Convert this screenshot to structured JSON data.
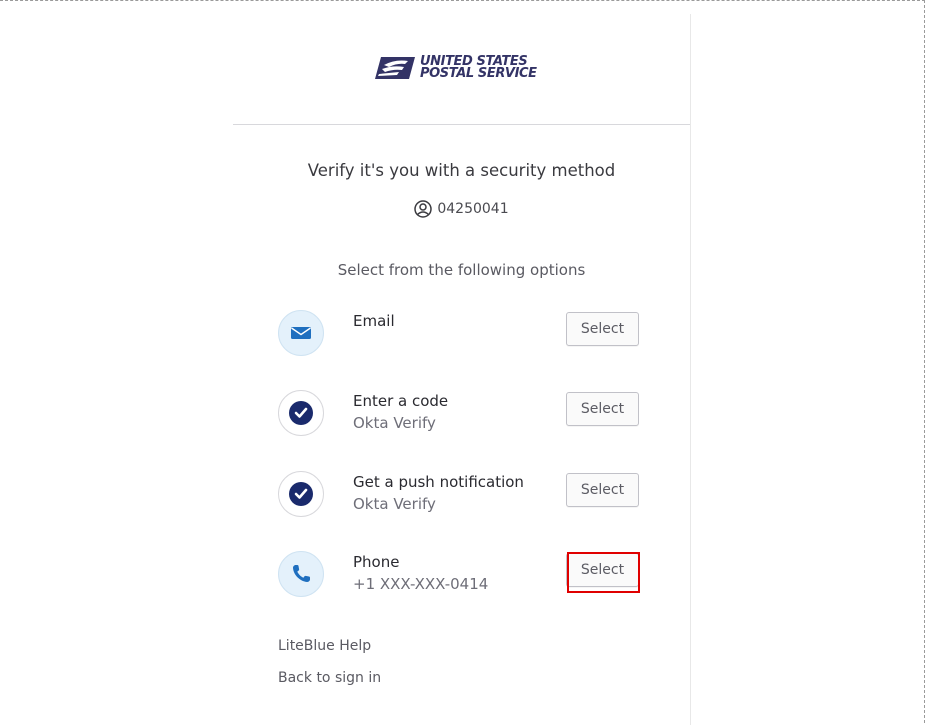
{
  "logo": {
    "line1": "UNITED STATES",
    "line2": "POSTAL SERVICE",
    "brand_color": "#333366"
  },
  "title": "Verify it's you with a security method",
  "user": {
    "icon": "user-circle-icon",
    "id": "04250041"
  },
  "subtitle": "Select from the following options",
  "methods": [
    {
      "label": "Email",
      "sub": "",
      "icon": "envelope-icon",
      "button": "Select"
    },
    {
      "label": "Enter a code",
      "sub": "Okta Verify",
      "icon": "okta-verify-icon",
      "button": "Select"
    },
    {
      "label": "Get a push notification",
      "sub": "Okta Verify",
      "icon": "okta-verify-icon",
      "button": "Select"
    },
    {
      "label": "Phone",
      "sub": "+1 XXX-XXX-0414",
      "icon": "phone-icon",
      "button": "Select"
    }
  ],
  "links": {
    "help": "LiteBlue Help",
    "back": "Back to sign in"
  },
  "colors": {
    "highlight": "#e00000",
    "okta_blue": "#1a2a6c",
    "phone_blue": "#1f6fbf",
    "icon_bg": "#e4f1fb"
  }
}
